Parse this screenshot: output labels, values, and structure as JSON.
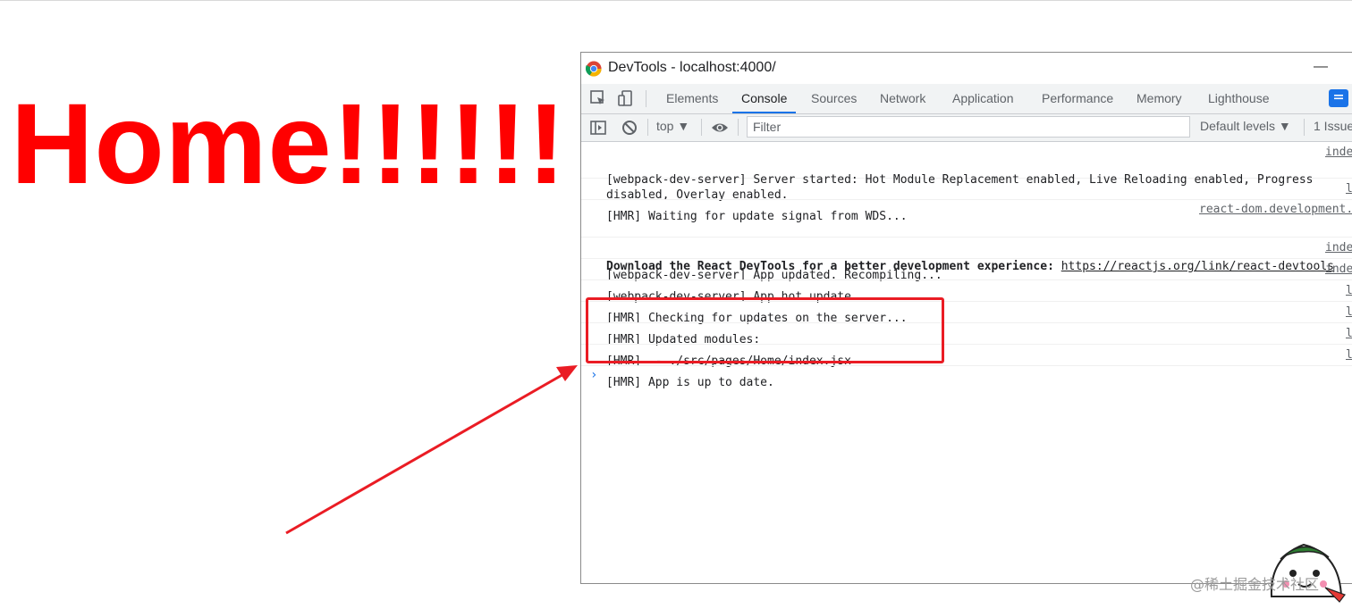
{
  "page": {
    "heading": "Home!!!!!!"
  },
  "window": {
    "title": "DevTools - localhost:4000/",
    "minimize": "—"
  },
  "tabs": [
    "Elements",
    "Console",
    "Sources",
    "Network",
    "Application",
    "Performance",
    "Memory",
    "Lighthouse"
  ],
  "active_tab": "Console",
  "toolbar": {
    "context": "top ▼",
    "filter_placeholder": "Filter",
    "levels": "Default levels ▼",
    "issues": "1 Issue"
  },
  "messages": [
    {
      "text": "[webpack-dev-server] Server started: Hot Module Replacement enabled, Live Reloading enabled, Progress\ndisabled, Overlay enabled.",
      "source": "inde"
    },
    {
      "text": "[HMR] Waiting for update signal from WDS...",
      "source": "l"
    },
    {
      "source_top": "react-dom.development.",
      "prefix": "Download the React DevTools for a better development experience: ",
      "link": "https://reactjs.org/link/react-devtools"
    },
    {
      "text": "[webpack-dev-server] App updated. Recompiling...",
      "source": "inde"
    },
    {
      "text": "[webpack-dev-server] App hot update...",
      "source": "inde"
    },
    {
      "text": "[HMR] Checking for updates on the server...",
      "source": "l"
    },
    {
      "text": "[HMR] Updated modules:",
      "source": "l"
    },
    {
      "text": "[HMR]  - ./src/pages/Home/index.jsx",
      "source": "l"
    },
    {
      "text": "[HMR] App is up to date.",
      "source": "l"
    }
  ],
  "prompt": "›",
  "watermark": "@稀土掘金技术社区",
  "colors": {
    "heading": "#ff0000",
    "annotation": "#ea1c24",
    "accent": "#1a73e8"
  }
}
